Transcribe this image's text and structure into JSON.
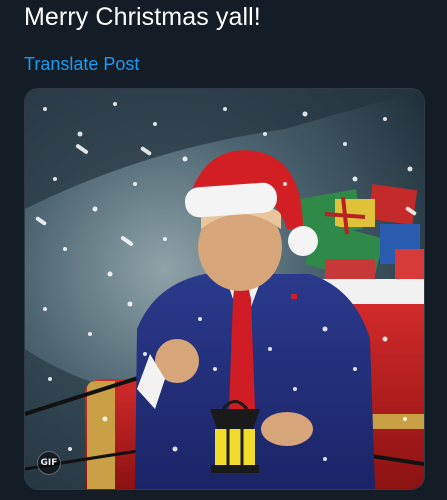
{
  "post": {
    "text": "Merry Christmas yall!",
    "translate_label": "Translate Post"
  },
  "media": {
    "type": "gif",
    "badge_label": "GIF"
  },
  "colors": {
    "background": "#141d26",
    "link": "#1d9bf0",
    "text": "#ffffff"
  }
}
